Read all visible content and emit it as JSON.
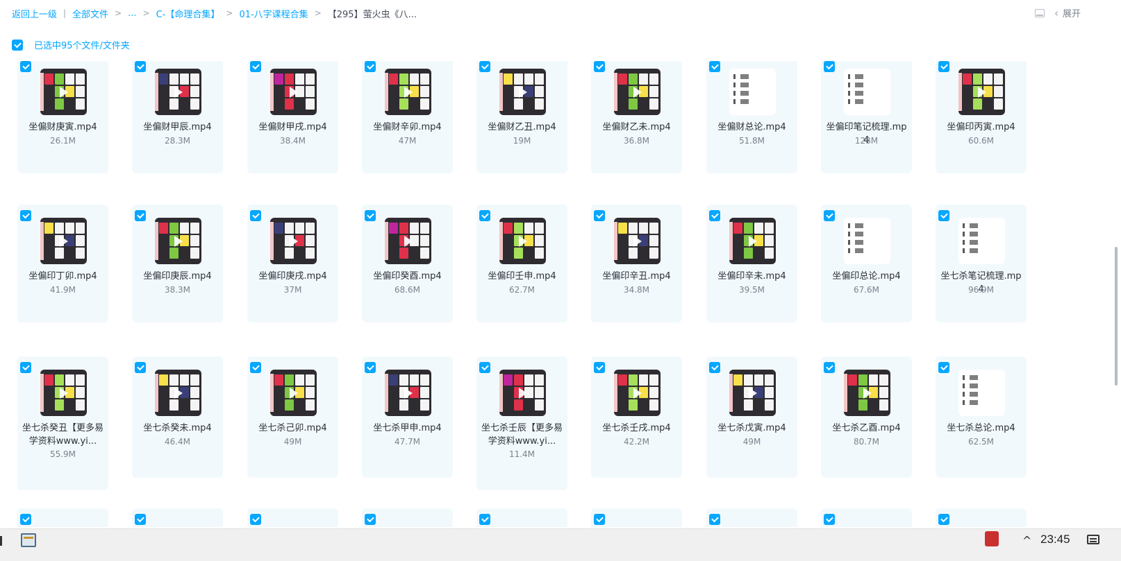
{
  "breadcrumb": {
    "back": "返回上一级",
    "items": [
      "全部文件",
      "...",
      "C-【命理合集】",
      "01-八字课程合集"
    ],
    "current": "【295】萤火虫《八..."
  },
  "topright": {
    "expand_label": "展开"
  },
  "selection": {
    "label": "已选中95个文件/文件夹"
  },
  "colors": {
    "accent": "#06a7ff",
    "card_bg": "#f2f9fd"
  },
  "files": [
    {
      "name": "坐偏财庚寅.mp4",
      "size": "26.1M",
      "type": "video"
    },
    {
      "name": "坐偏财甲辰.mp4",
      "size": "28.3M",
      "type": "video"
    },
    {
      "name": "坐偏财甲戌.mp4",
      "size": "38.4M",
      "type": "video"
    },
    {
      "name": "坐偏财辛卯.mp4",
      "size": "47M",
      "type": "video"
    },
    {
      "name": "坐偏财乙丑.mp4",
      "size": "19M",
      "type": "video"
    },
    {
      "name": "坐偏财乙未.mp4",
      "size": "36.8M",
      "type": "video"
    },
    {
      "name": "坐偏财总论.mp4",
      "size": "51.8M",
      "type": "doc"
    },
    {
      "name": "坐偏印笔记梳理.mp4",
      "size": "128M",
      "type": "doc"
    },
    {
      "name": "坐偏印丙寅.mp4",
      "size": "60.6M",
      "type": "video"
    },
    {
      "name": "坐偏印丁卯.mp4",
      "size": "41.9M",
      "type": "video"
    },
    {
      "name": "坐偏印庚辰.mp4",
      "size": "38.3M",
      "type": "video"
    },
    {
      "name": "坐偏印庚戌.mp4",
      "size": "37M",
      "type": "video"
    },
    {
      "name": "坐偏印癸酉.mp4",
      "size": "68.6M",
      "type": "video"
    },
    {
      "name": "坐偏印壬申.mp4",
      "size": "62.7M",
      "type": "video"
    },
    {
      "name": "坐偏印辛丑.mp4",
      "size": "34.8M",
      "type": "video"
    },
    {
      "name": "坐偏印辛未.mp4",
      "size": "39.5M",
      "type": "video"
    },
    {
      "name": "坐偏印总论.mp4",
      "size": "67.6M",
      "type": "doc"
    },
    {
      "name": "坐七杀笔记梳理.mp4",
      "size": "96.9M",
      "type": "doc"
    },
    {
      "name": "坐七杀癸丑【更多易学资料www.yi...",
      "size": "55.9M",
      "type": "video"
    },
    {
      "name": "坐七杀癸未.mp4",
      "size": "46.4M",
      "type": "video"
    },
    {
      "name": "坐七杀己卯.mp4",
      "size": "49M",
      "type": "video"
    },
    {
      "name": "坐七杀甲申.mp4",
      "size": "47.7M",
      "type": "video"
    },
    {
      "name": "坐七杀壬辰【更多易学资料www.yi...",
      "size": "11.4M",
      "type": "video"
    },
    {
      "name": "坐七杀壬戌.mp4",
      "size": "42.2M",
      "type": "video"
    },
    {
      "name": "坐七杀戊寅.mp4",
      "size": "49M",
      "type": "video"
    },
    {
      "name": "坐七杀乙酉.mp4",
      "size": "80.7M",
      "type": "video"
    },
    {
      "name": "坐七杀总论.mp4",
      "size": "62.5M",
      "type": "doc"
    },
    {
      "name": "",
      "size": "",
      "type": "video"
    },
    {
      "name": "",
      "size": "",
      "type": "video"
    },
    {
      "name": "",
      "size": "",
      "type": "video"
    },
    {
      "name": "",
      "size": "",
      "type": "video"
    },
    {
      "name": "",
      "size": "",
      "type": "video"
    },
    {
      "name": "",
      "size": "",
      "type": "video"
    },
    {
      "name": "",
      "size": "",
      "type": "video"
    },
    {
      "name": "",
      "size": "",
      "type": "video"
    },
    {
      "name": "",
      "size": "",
      "type": "video"
    }
  ],
  "taskbar": {
    "time": "23:45"
  }
}
